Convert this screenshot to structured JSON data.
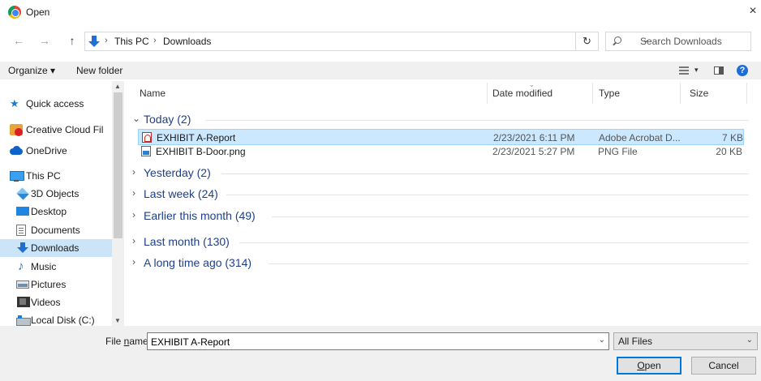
{
  "window": {
    "title": "Open",
    "close_glyph": "×"
  },
  "nav": {
    "back": "←",
    "forward": "→",
    "up": "↑"
  },
  "address": {
    "crumbs": [
      "This PC",
      "Downloads"
    ],
    "separator": "›",
    "dropdown": "⌄",
    "refresh": "↻"
  },
  "search": {
    "placeholder": "Search Downloads"
  },
  "toolbar": {
    "organize": "Organize ▾",
    "new_folder": "New folder",
    "view_dropdown": "▾",
    "help": "?"
  },
  "sidebar": {
    "items": [
      {
        "label": "Quick access",
        "icon": "star-icon"
      },
      {
        "label": "Creative Cloud Fil",
        "icon": "creative-cloud-icon"
      },
      {
        "label": "OneDrive",
        "icon": "cloud-icon"
      },
      {
        "label": "This PC",
        "icon": "pc-icon"
      },
      {
        "label": "3D Objects",
        "icon": "cube-icon"
      },
      {
        "label": "Desktop",
        "icon": "desktop-icon"
      },
      {
        "label": "Documents",
        "icon": "document-icon"
      },
      {
        "label": "Downloads",
        "icon": "download-icon"
      },
      {
        "label": "Music",
        "icon": "music-icon"
      },
      {
        "label": "Pictures",
        "icon": "pictures-icon"
      },
      {
        "label": "Videos",
        "icon": "video-icon"
      },
      {
        "label": "Local Disk (C:)",
        "icon": "disk-icon"
      }
    ]
  },
  "columns": {
    "name": "Name",
    "date": "Date modified",
    "type": "Type",
    "size": "Size"
  },
  "groups": [
    {
      "label": "Today (2)",
      "expanded": true
    },
    {
      "label": "Yesterday (2)",
      "expanded": false
    },
    {
      "label": "Last week (24)",
      "expanded": false
    },
    {
      "label": "Earlier this month (49)",
      "expanded": false
    },
    {
      "label": "Last month (130)",
      "expanded": false
    },
    {
      "label": "A long time ago (314)",
      "expanded": false
    }
  ],
  "files": [
    {
      "name": "EXHIBIT A-Report",
      "date": "2/23/2021 6:11 PM",
      "type": "Adobe Acrobat D...",
      "size": "7 KB",
      "icon": "pdf-icon"
    },
    {
      "name": "EXHIBIT B-Door.png",
      "date": "2/23/2021 5:27 PM",
      "type": "PNG File",
      "size": "20 KB",
      "icon": "png-icon"
    }
  ],
  "bottom": {
    "filename_label_pre": "File ",
    "filename_label_ul": "n",
    "filename_label_post": "ame:",
    "filename_value": "EXHIBIT A-Report",
    "filter": "All Files",
    "open_ul": "O",
    "open_rest": "pen",
    "cancel": "Cancel"
  }
}
